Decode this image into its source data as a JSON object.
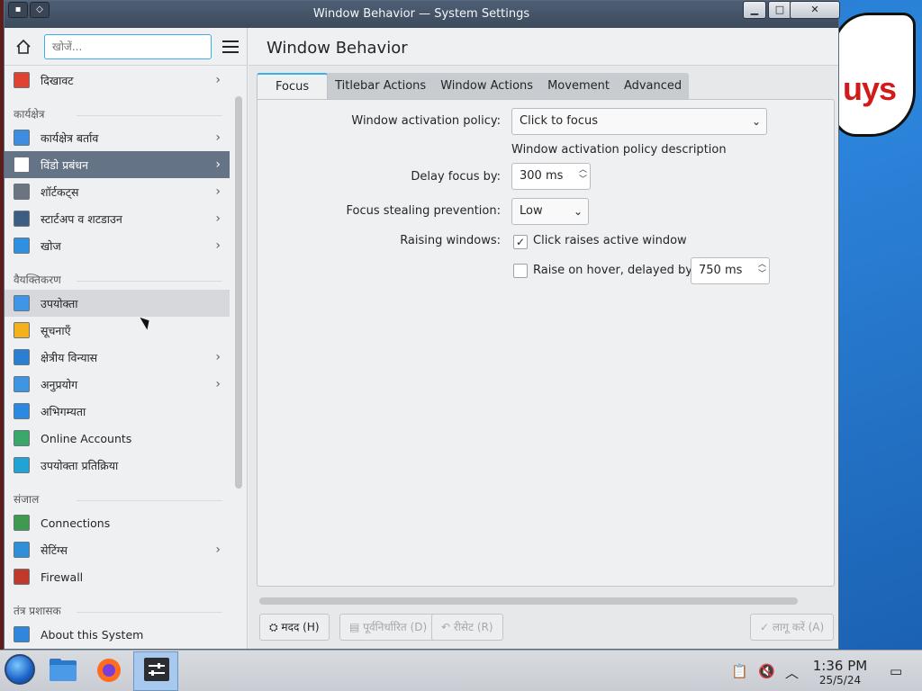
{
  "window": {
    "title": "Window Behavior — System Settings"
  },
  "desktop": {
    "cloud_text": "uys"
  },
  "sidebar": {
    "search_placeholder": "खोजें...",
    "items_top": [
      {
        "label": "दिखावट",
        "icon": "appearance-icon",
        "chevron": true
      }
    ],
    "sections": [
      {
        "heading": "कार्यक्षेत्र",
        "items": [
          {
            "label": "कार्यक्षेत्र बर्ताव",
            "icon": "workspace-behavior-icon",
            "chevron": true
          },
          {
            "label": "विंडो प्रबंधन",
            "icon": "window-management-icon",
            "chevron": true,
            "selected": true
          },
          {
            "label": "शॉर्टकट्स",
            "icon": "keyboard-icon",
            "chevron": true
          },
          {
            "label": "स्टार्टअप व शटडाउन",
            "icon": "startup-icon",
            "chevron": true
          },
          {
            "label": "खोज",
            "icon": "search-icon",
            "chevron": true
          }
        ]
      },
      {
        "heading": "वैयक्तिकरण",
        "items": [
          {
            "label": "उपयोक्ता",
            "icon": "users-icon",
            "chevron": false,
            "hover": true
          },
          {
            "label": "सूचनाएँ",
            "icon": "bell-icon",
            "chevron": false
          },
          {
            "label": "क्षेत्रीय विन्यास",
            "icon": "regional-icon",
            "chevron": true
          },
          {
            "label": "अनुप्रयोग",
            "icon": "applications-icon",
            "chevron": true
          },
          {
            "label": "अभिगम्यता",
            "icon": "accessibility-icon",
            "chevron": false
          },
          {
            "label": "Online Accounts",
            "icon": "online-accounts-icon",
            "chevron": false
          },
          {
            "label": "उपयोक्ता प्रतिक्रिया",
            "icon": "feedback-icon",
            "chevron": false
          }
        ]
      },
      {
        "heading": "संजाल",
        "items": [
          {
            "label": "Connections",
            "icon": "globe-icon",
            "chevron": false
          },
          {
            "label": "सेटिंग्स",
            "icon": "network-settings-icon",
            "chevron": true
          },
          {
            "label": "Firewall",
            "icon": "firewall-icon",
            "chevron": false
          }
        ]
      },
      {
        "heading": "तंत्र प्रशासक",
        "items": [
          {
            "label": "About this System",
            "icon": "info-icon",
            "chevron": false
          }
        ]
      }
    ]
  },
  "main": {
    "title": "Window Behavior",
    "tabs": [
      "Focus",
      "Titlebar Actions",
      "Window Actions",
      "Movement",
      "Advanced"
    ],
    "active_tab": "Focus",
    "focus": {
      "activation_policy_label": "Window activation policy:",
      "activation_policy_value": "Click to focus",
      "activation_policy_description": "Window activation policy description",
      "delay_label": "Delay focus by:",
      "delay_value": "300 ms",
      "stealing_label": "Focus stealing prevention:",
      "stealing_value": "Low",
      "raising_label": "Raising windows:",
      "click_raises_label": "Click raises active window",
      "click_raises_checked": true,
      "raise_hover_label": "Raise on hover, delayed by:",
      "raise_hover_checked": false,
      "raise_hover_value": "750 ms"
    },
    "footer": {
      "help": "मदद (H)",
      "defaults": "पूर्वनिर्धारित (D)",
      "reset": "रीसेट (R)",
      "apply": "लागू करें (A)"
    }
  },
  "taskbar": {
    "time": "1:36 PM",
    "date": "25/5/24"
  }
}
